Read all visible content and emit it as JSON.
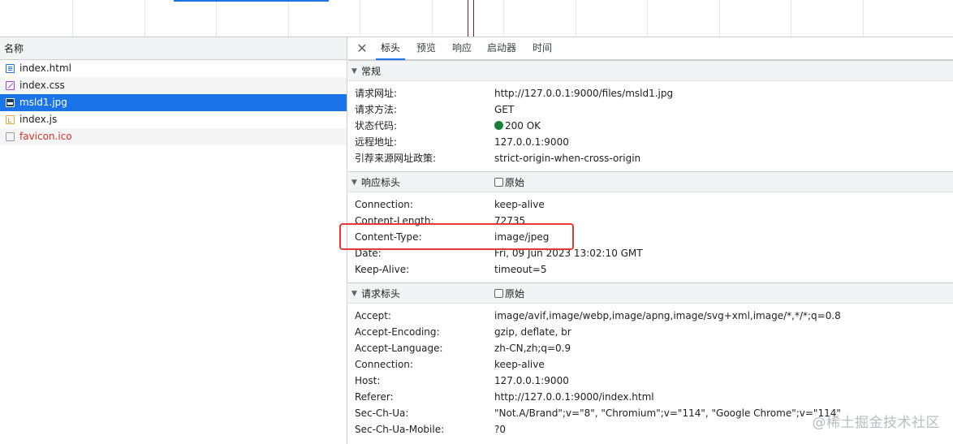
{
  "request_list": {
    "header": "名称",
    "items": [
      {
        "name": "index.html",
        "icon": "html-document-icon",
        "selected": false,
        "error": false
      },
      {
        "name": "index.css",
        "icon": "css-file-icon",
        "selected": false,
        "error": false
      },
      {
        "name": "msld1.jpg",
        "icon": "image-file-icon",
        "selected": true,
        "error": false
      },
      {
        "name": "index.js",
        "icon": "js-file-icon",
        "selected": false,
        "error": false
      },
      {
        "name": "favicon.ico",
        "icon": "generic-file-icon",
        "selected": false,
        "error": true
      }
    ]
  },
  "details": {
    "close_icon": "close-icon",
    "tabs": [
      {
        "label": "标头",
        "active": true
      },
      {
        "label": "预览",
        "active": false
      },
      {
        "label": "响应",
        "active": false
      },
      {
        "label": "启动器",
        "active": false
      },
      {
        "label": "时间",
        "active": false
      }
    ],
    "general": {
      "title": "常规",
      "rows": [
        {
          "key": "请求网址:",
          "value": "http://127.0.0.1:9000/files/msld1.jpg"
        },
        {
          "key": "请求方法:",
          "value": "GET"
        },
        {
          "key": "状态代码:",
          "value": "200 OK"
        },
        {
          "key": "远程地址:",
          "value": "127.0.0.1:9000"
        },
        {
          "key": "引荐来源网址政策:",
          "value": "strict-origin-when-cross-origin"
        }
      ]
    },
    "response_headers": {
      "title": "响应标头",
      "raw_label": "原始",
      "rows": [
        {
          "key": "Connection:",
          "value": "keep-alive"
        },
        {
          "key": "Content-Length:",
          "value": "72735"
        },
        {
          "key": "Content-Type:",
          "value": "image/jpeg"
        },
        {
          "key": "Date:",
          "value": "Fri, 09 Jun 2023 13:02:10 GMT"
        },
        {
          "key": "Keep-Alive:",
          "value": "timeout=5"
        }
      ]
    },
    "request_headers": {
      "title": "请求标头",
      "raw_label": "原始",
      "rows": [
        {
          "key": "Accept:",
          "value": "image/avif,image/webp,image/apng,image/svg+xml,image/*,*/*;q=0.8"
        },
        {
          "key": "Accept-Encoding:",
          "value": "gzip, deflate, br"
        },
        {
          "key": "Accept-Language:",
          "value": "zh-CN,zh;q=0.9"
        },
        {
          "key": "Connection:",
          "value": "keep-alive"
        },
        {
          "key": "Host:",
          "value": "127.0.0.1:9000"
        },
        {
          "key": "Referer:",
          "value": "http://127.0.0.1:9000/index.html"
        },
        {
          "key": "Sec-Ch-Ua:",
          "value": "\"Not.A/Brand\";v=\"8\", \"Chromium\";v=\"114\", \"Google Chrome\";v=\"114\""
        },
        {
          "key": "Sec-Ch-Ua-Mobile:",
          "value": "?0"
        }
      ]
    }
  },
  "status_color": "#188038",
  "accent_color": "#1a73e8",
  "highlight_color": "#e53935",
  "watermark": "@稀土掘金技术社区"
}
